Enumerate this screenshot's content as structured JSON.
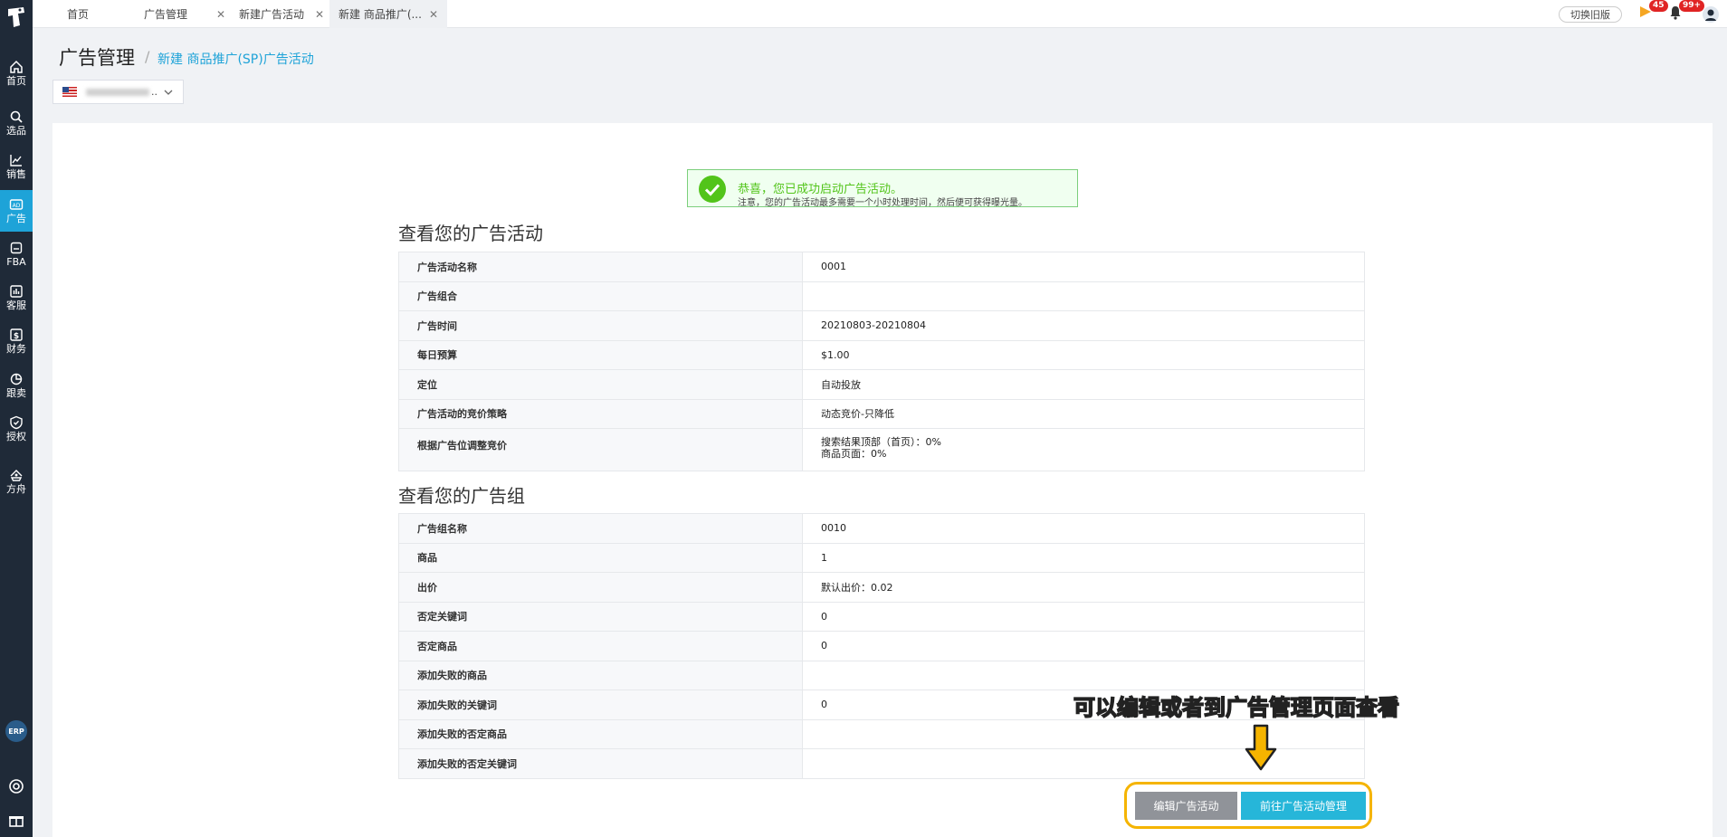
{
  "sidebar": {
    "items": [
      {
        "label": "首页",
        "icon": "home-icon"
      },
      {
        "label": "选品",
        "icon": "search-icon"
      },
      {
        "label": "销售",
        "icon": "chart-line-icon"
      },
      {
        "label": "广告",
        "icon": "ad-icon",
        "active": true
      },
      {
        "label": "FBA",
        "icon": "box-icon"
      },
      {
        "label": "客服",
        "icon": "bar-chart-icon"
      },
      {
        "label": "财务",
        "icon": "dollar-icon"
      },
      {
        "label": "跟卖",
        "icon": "pie-chart-icon"
      },
      {
        "label": "授权",
        "icon": "shield-check-icon"
      },
      {
        "label": "方舟",
        "icon": "ark-icon"
      }
    ],
    "erp_label": "ERP"
  },
  "tabs": [
    {
      "label": "首页",
      "closable": false
    },
    {
      "label": "广告管理",
      "closable": true
    },
    {
      "label": "新建广告活动",
      "closable": true
    },
    {
      "label": "新建 商品推广(...",
      "closable": true,
      "active": true
    }
  ],
  "topbar": {
    "switch_label": "切换旧版",
    "flag_badge": "45",
    "bell_badge": "99+"
  },
  "header": {
    "title": "广告管理",
    "separator": "/",
    "subtitle": "新建 商品推广(SP)广告活动"
  },
  "store": {
    "suffix": ".."
  },
  "success": {
    "title": "恭喜，您已成功启动广告活动。",
    "note": "注意，您的广告活动最多需要一个小时处理时间，然后便可获得曝光量。"
  },
  "campaign_section": {
    "title": "查看您的广告活动",
    "rows": [
      {
        "key": "广告活动名称",
        "value": "0001"
      },
      {
        "key": "广告组合",
        "value": ""
      },
      {
        "key": "广告时间",
        "value": "20210803-20210804"
      },
      {
        "key": "每日预算",
        "value": "$1.00"
      },
      {
        "key": "定位",
        "value": "自动投放"
      },
      {
        "key": "广告活动的竞价策略",
        "value": "动态竞价-只降低"
      },
      {
        "key": "根据广告位调整竞价",
        "value": "搜索结果顶部（首页）：0%",
        "value2": "商品页面：0%"
      }
    ]
  },
  "adgroup_section": {
    "title": "查看您的广告组",
    "rows": [
      {
        "key": "广告组名称",
        "value": "0010"
      },
      {
        "key": "商品",
        "value": "1"
      },
      {
        "key": "出价",
        "value": "默认出价：0.02"
      },
      {
        "key": "否定关键词",
        "value": "0"
      },
      {
        "key": "否定商品",
        "value": "0"
      },
      {
        "key": "添加失败的商品",
        "value": ""
      },
      {
        "key": "添加失败的关键词",
        "value": "0"
      },
      {
        "key": "添加失败的否定商品",
        "value": ""
      },
      {
        "key": "添加失败的否定关键词",
        "value": ""
      }
    ]
  },
  "annotation": "可以编辑或者到广告管理页面查看",
  "buttons": {
    "edit": "编辑广告活动",
    "goto": "前往广告活动管理"
  },
  "colors": {
    "sidebar": "#1f2a38",
    "accent": "#1ea3d8",
    "success": "#52c41a",
    "highlight": "#f5b400"
  }
}
